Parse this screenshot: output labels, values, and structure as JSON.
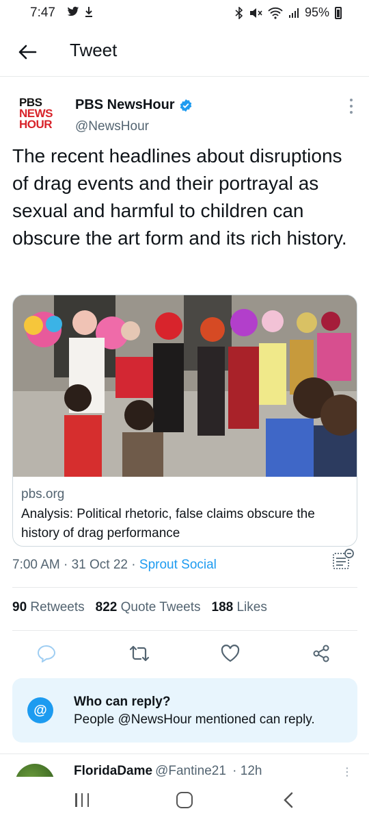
{
  "status_bar": {
    "time": "7:47",
    "battery": "95%",
    "icons": [
      "twitter-icon",
      "download-icon",
      "bluetooth-icon",
      "mute-icon",
      "wifi-icon",
      "signal-icon",
      "battery-icon"
    ]
  },
  "header": {
    "title": "Tweet"
  },
  "author": {
    "logo_lines": [
      "PBS",
      "NEWS",
      "HOUR"
    ],
    "name": "PBS NewsHour",
    "handle": "@NewsHour",
    "verified": true
  },
  "tweet": {
    "text": "The recent headlines about disruptions of drag events and their portrayal as sexual and harmful to children can obscure the art form and its rich history."
  },
  "link_card": {
    "domain": "pbs.org",
    "title": "Analysis: Political rhetoric, false claims obscure the history of drag performance"
  },
  "meta": {
    "time": "7:00 AM",
    "date": "31 Oct 22",
    "source": "Sprout Social",
    "separator": " · "
  },
  "stats": {
    "retweets_count": "90",
    "retweets_label": "Retweets",
    "quotes_count": "822",
    "quotes_label": "Quote Tweets",
    "likes_count": "188",
    "likes_label": "Likes"
  },
  "reply_notice": {
    "title": "Who can reply?",
    "description": "People @NewsHour mentioned can reply."
  },
  "next_tweet": {
    "name": "FloridaDame",
    "handle": "@Fantine21",
    "time": "· 12h"
  },
  "colors": {
    "accent": "#1d9bf0",
    "secondary_text": "#536471",
    "reply_bg": "#e8f5fd",
    "pbs_red": "#d8232a"
  }
}
